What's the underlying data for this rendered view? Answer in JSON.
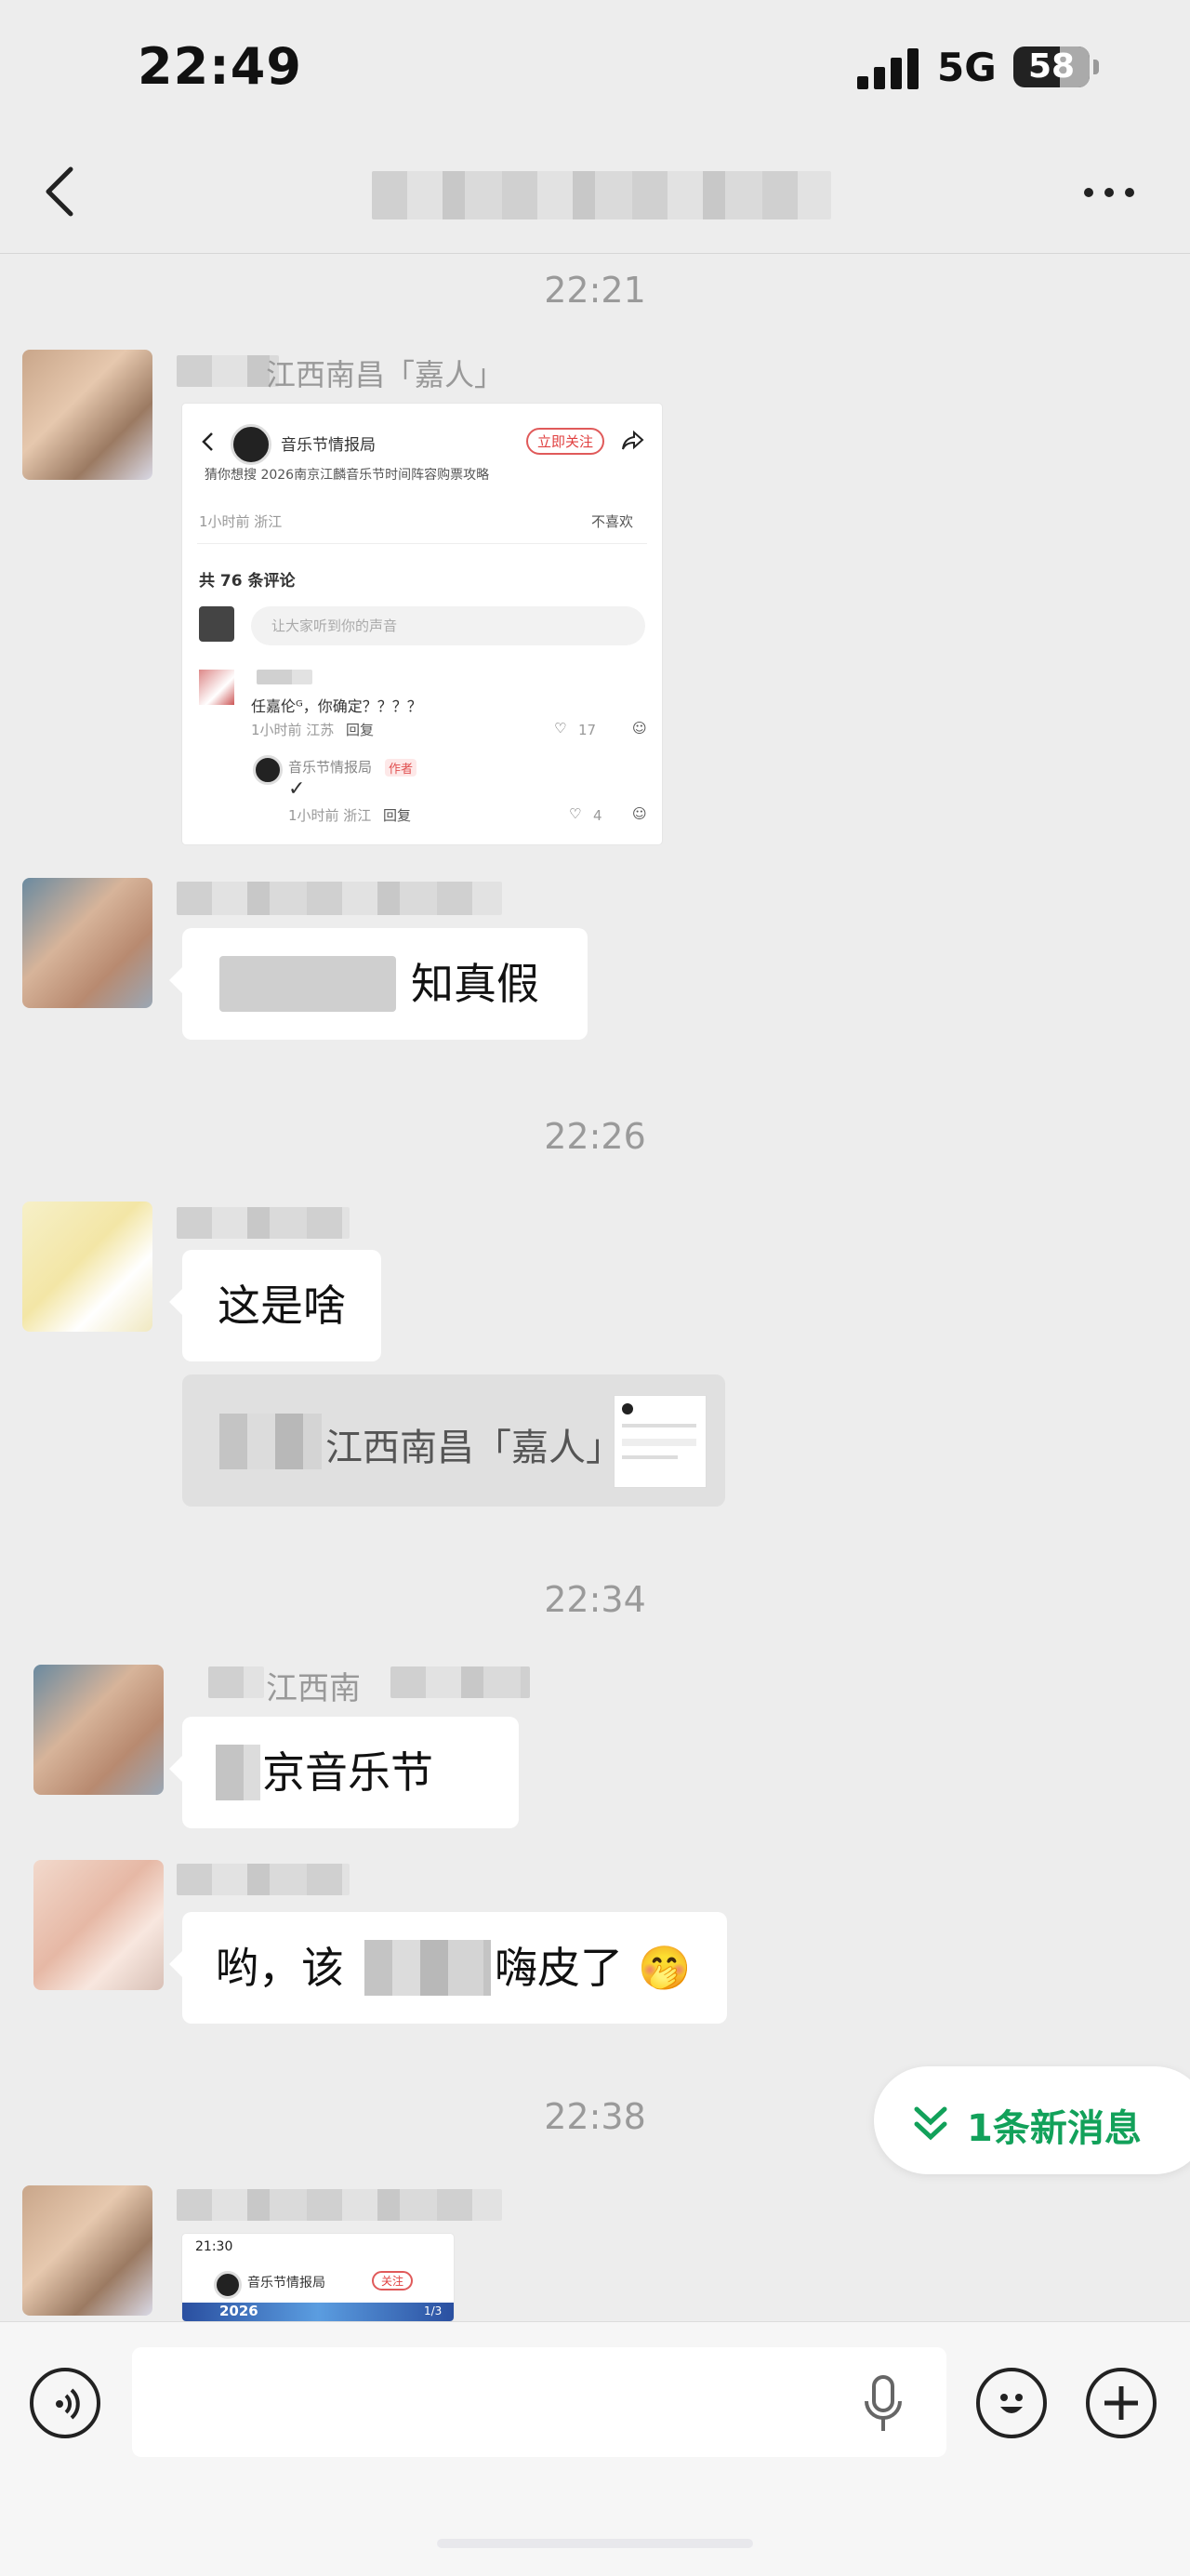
{
  "status_bar": {
    "time": "22:49",
    "network": "5G",
    "battery": "58"
  },
  "header": {
    "title": "",
    "more_label": "···"
  },
  "messages": {
    "ts1": "22:21",
    "m1_sender": "江西南昌「嘉人」",
    "card": {
      "account": "音乐节情报局",
      "follow": "立即关注",
      "headline": "猜你想搜  2026南京江麟音乐节时间阵容购票攻略",
      "meta": "1小时前 浙江",
      "dislike": "不喜欢",
      "comments": "共 76 条评论",
      "placeholder": "让大家听到你的声音",
      "c1_text": "任嘉伦ᴳ，你确定？？？？",
      "c1_meta": "1小时前 江苏",
      "reply": "回复",
      "c1_likes": "17",
      "c2_author": "音乐节情报局",
      "author_tag": "作者",
      "c2_text": "✓",
      "c2_meta": "1小时前 浙江",
      "c2_likes": "4"
    },
    "m2_text": "知真假",
    "ts2": "22:26",
    "m3_text": "这是啥",
    "quote_text": "江西南昌「嘉人」:",
    "ts3": "22:34",
    "m4_sender": "江西南",
    "m4_text": "京音乐节",
    "m5_text_a": "哟，该",
    "m5_text_b": "嗨皮了",
    "m5_emoji": "🤭",
    "ts4": "22:38",
    "card2": {
      "time": "21:30",
      "account": "音乐节情报局",
      "follow": "关注",
      "banner": "2026",
      "page": "1/3"
    }
  },
  "new_messages": "1条新消息"
}
